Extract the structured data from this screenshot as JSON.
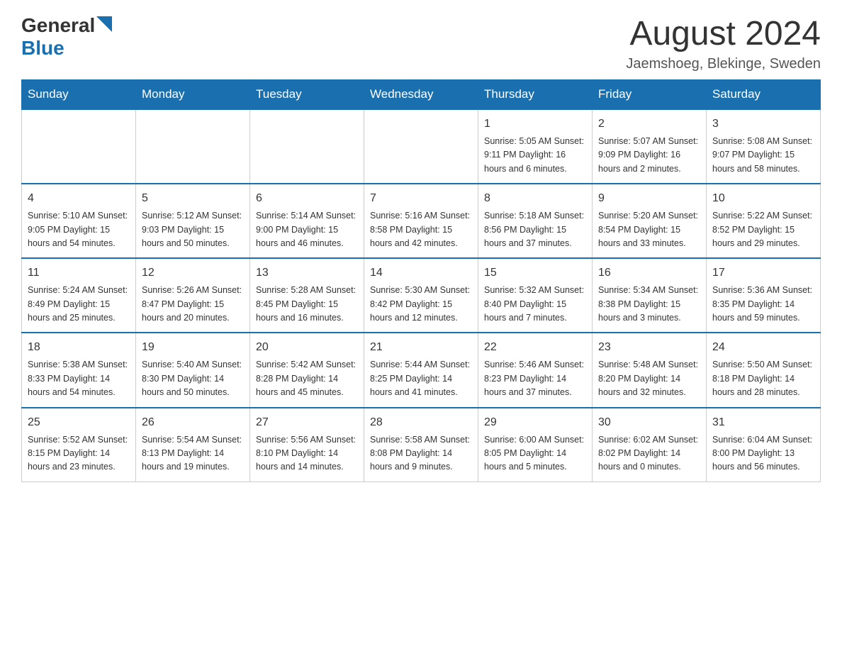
{
  "header": {
    "logo_general": "General",
    "logo_blue": "Blue",
    "month_title": "August 2024",
    "location": "Jaemshoeg, Blekinge, Sweden"
  },
  "days_of_week": [
    "Sunday",
    "Monday",
    "Tuesday",
    "Wednesday",
    "Thursday",
    "Friday",
    "Saturday"
  ],
  "weeks": [
    [
      {
        "day": "",
        "info": ""
      },
      {
        "day": "",
        "info": ""
      },
      {
        "day": "",
        "info": ""
      },
      {
        "day": "",
        "info": ""
      },
      {
        "day": "1",
        "info": "Sunrise: 5:05 AM\nSunset: 9:11 PM\nDaylight: 16 hours and 6 minutes."
      },
      {
        "day": "2",
        "info": "Sunrise: 5:07 AM\nSunset: 9:09 PM\nDaylight: 16 hours and 2 minutes."
      },
      {
        "day": "3",
        "info": "Sunrise: 5:08 AM\nSunset: 9:07 PM\nDaylight: 15 hours and 58 minutes."
      }
    ],
    [
      {
        "day": "4",
        "info": "Sunrise: 5:10 AM\nSunset: 9:05 PM\nDaylight: 15 hours and 54 minutes."
      },
      {
        "day": "5",
        "info": "Sunrise: 5:12 AM\nSunset: 9:03 PM\nDaylight: 15 hours and 50 minutes."
      },
      {
        "day": "6",
        "info": "Sunrise: 5:14 AM\nSunset: 9:00 PM\nDaylight: 15 hours and 46 minutes."
      },
      {
        "day": "7",
        "info": "Sunrise: 5:16 AM\nSunset: 8:58 PM\nDaylight: 15 hours and 42 minutes."
      },
      {
        "day": "8",
        "info": "Sunrise: 5:18 AM\nSunset: 8:56 PM\nDaylight: 15 hours and 37 minutes."
      },
      {
        "day": "9",
        "info": "Sunrise: 5:20 AM\nSunset: 8:54 PM\nDaylight: 15 hours and 33 minutes."
      },
      {
        "day": "10",
        "info": "Sunrise: 5:22 AM\nSunset: 8:52 PM\nDaylight: 15 hours and 29 minutes."
      }
    ],
    [
      {
        "day": "11",
        "info": "Sunrise: 5:24 AM\nSunset: 8:49 PM\nDaylight: 15 hours and 25 minutes."
      },
      {
        "day": "12",
        "info": "Sunrise: 5:26 AM\nSunset: 8:47 PM\nDaylight: 15 hours and 20 minutes."
      },
      {
        "day": "13",
        "info": "Sunrise: 5:28 AM\nSunset: 8:45 PM\nDaylight: 15 hours and 16 minutes."
      },
      {
        "day": "14",
        "info": "Sunrise: 5:30 AM\nSunset: 8:42 PM\nDaylight: 15 hours and 12 minutes."
      },
      {
        "day": "15",
        "info": "Sunrise: 5:32 AM\nSunset: 8:40 PM\nDaylight: 15 hours and 7 minutes."
      },
      {
        "day": "16",
        "info": "Sunrise: 5:34 AM\nSunset: 8:38 PM\nDaylight: 15 hours and 3 minutes."
      },
      {
        "day": "17",
        "info": "Sunrise: 5:36 AM\nSunset: 8:35 PM\nDaylight: 14 hours and 59 minutes."
      }
    ],
    [
      {
        "day": "18",
        "info": "Sunrise: 5:38 AM\nSunset: 8:33 PM\nDaylight: 14 hours and 54 minutes."
      },
      {
        "day": "19",
        "info": "Sunrise: 5:40 AM\nSunset: 8:30 PM\nDaylight: 14 hours and 50 minutes."
      },
      {
        "day": "20",
        "info": "Sunrise: 5:42 AM\nSunset: 8:28 PM\nDaylight: 14 hours and 45 minutes."
      },
      {
        "day": "21",
        "info": "Sunrise: 5:44 AM\nSunset: 8:25 PM\nDaylight: 14 hours and 41 minutes."
      },
      {
        "day": "22",
        "info": "Sunrise: 5:46 AM\nSunset: 8:23 PM\nDaylight: 14 hours and 37 minutes."
      },
      {
        "day": "23",
        "info": "Sunrise: 5:48 AM\nSunset: 8:20 PM\nDaylight: 14 hours and 32 minutes."
      },
      {
        "day": "24",
        "info": "Sunrise: 5:50 AM\nSunset: 8:18 PM\nDaylight: 14 hours and 28 minutes."
      }
    ],
    [
      {
        "day": "25",
        "info": "Sunrise: 5:52 AM\nSunset: 8:15 PM\nDaylight: 14 hours and 23 minutes."
      },
      {
        "day": "26",
        "info": "Sunrise: 5:54 AM\nSunset: 8:13 PM\nDaylight: 14 hours and 19 minutes."
      },
      {
        "day": "27",
        "info": "Sunrise: 5:56 AM\nSunset: 8:10 PM\nDaylight: 14 hours and 14 minutes."
      },
      {
        "day": "28",
        "info": "Sunrise: 5:58 AM\nSunset: 8:08 PM\nDaylight: 14 hours and 9 minutes."
      },
      {
        "day": "29",
        "info": "Sunrise: 6:00 AM\nSunset: 8:05 PM\nDaylight: 14 hours and 5 minutes."
      },
      {
        "day": "30",
        "info": "Sunrise: 6:02 AM\nSunset: 8:02 PM\nDaylight: 14 hours and 0 minutes."
      },
      {
        "day": "31",
        "info": "Sunrise: 6:04 AM\nSunset: 8:00 PM\nDaylight: 13 hours and 56 minutes."
      }
    ]
  ]
}
